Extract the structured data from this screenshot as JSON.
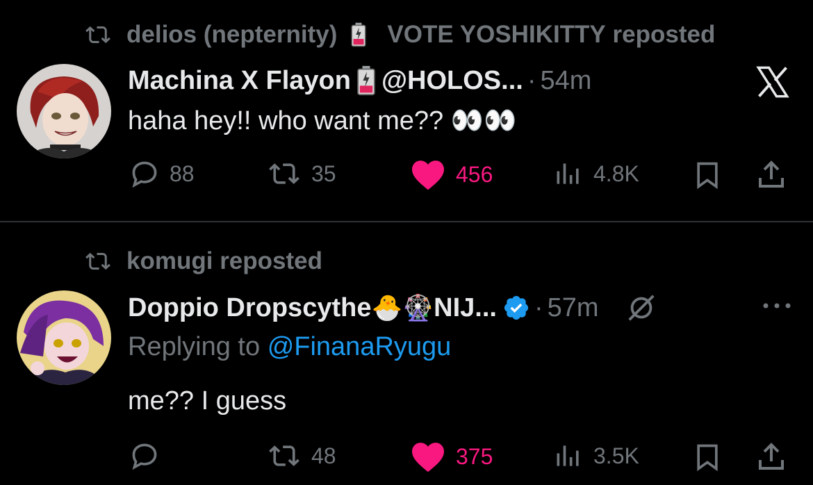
{
  "tweets": [
    {
      "repost_user": "delios (nepternity)",
      "repost_extra": "VOTE YOSHIKITTY",
      "repost_suffix": "reposted",
      "name": "Machina X Flayon",
      "handle": "@HOLOS...",
      "dot": "·",
      "time": "54m",
      "text": "haha hey!! who want me?? 👀👀",
      "replies": "88",
      "reposts": "35",
      "likes": "456",
      "views": "4.8K"
    },
    {
      "repost_user": "komugi",
      "repost_suffix": "reposted",
      "name": "Doppio Dropscythe",
      "name_suffix": "NIJ...",
      "name_emoji": "🐣🎡",
      "dot": "·",
      "time": "57m",
      "replying_prefix": "Replying to",
      "replying_to": "@FinanaRyugu",
      "text": "me?? I guess",
      "replies": "",
      "reposts": "48",
      "likes": "375",
      "views": "3.5K"
    }
  ],
  "icons": {
    "reply": "reply-icon",
    "repost": "repost-icon",
    "like": "heart-icon",
    "views": "views-icon",
    "bookmark": "bookmark-icon",
    "share": "share-icon",
    "x": "x-logo-icon",
    "more": "more-icon",
    "grok": "grok-icon",
    "verified": "verified-badge-icon"
  },
  "colors": {
    "background": "#000000",
    "text": "#e7e9ea",
    "muted": "#71767b",
    "link": "#1d9bf0",
    "like": "#f91880"
  }
}
